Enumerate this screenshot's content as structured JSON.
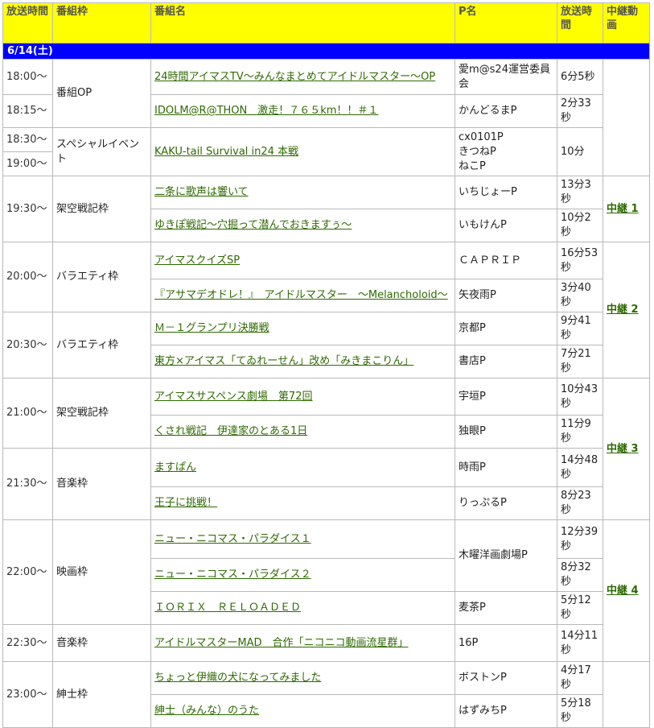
{
  "headers": {
    "time": "放送時間",
    "slot": "番組枠",
    "program": "番組名",
    "producer": "P名",
    "duration": "放送時間",
    "relay": "中継動画"
  },
  "date": "6/14(土)",
  "rows": [
    {
      "time": "18:00～",
      "slot": "番組OP",
      "program": "24時間アイマスTV～みんなまとめてアイドルマスター～OP",
      "producer": "愛m@s24運営委員会",
      "duration": "6分5秒"
    },
    {
      "time": "18:15～",
      "program": "IDOLM@R@THON　激走！７６５km！！＃１",
      "producer": "かんどるまP",
      "duration": "2分33秒"
    },
    {
      "time": "18:30～",
      "slot": "スペシャルイベント",
      "program": "KAKU-tail Survival in24 本戦",
      "producer_lines": [
        "cx0101P",
        "きつねP",
        "ねこP"
      ],
      "duration": "10分"
    },
    {
      "time": "19:00～"
    },
    {
      "time": "19:30～",
      "slot": "架空戦記枠",
      "program": "二条に歌声は響いて",
      "producer": "いちじょーP",
      "duration": "13分3秒",
      "relay": "中継 1"
    },
    {
      "program": "ゆきぽ戦記～穴掘って潜んでおきますぅ～",
      "producer": "いもけんP",
      "duration": "10分2秒"
    },
    {
      "time": "20:00～",
      "slot": "バラエティ枠",
      "program": "アイマスクイズSP",
      "producer": "ＣＡＰＲＩＰ",
      "duration": "16分53秒",
      "relay": "中継 2"
    },
    {
      "program": "『アサマデオドレ！』　アイドルマスター　～Melancholoid～",
      "producer": "矢夜雨P",
      "duration": "3分40秒"
    },
    {
      "time": "20:30～",
      "slot": "バラエティ枠",
      "program": "Ｍ－１グランプリ決勝戦",
      "producer": "京都P",
      "duration": "9分41秒"
    },
    {
      "program": "東方×アイマス「てゐれーせん」改め「みきまこりん」",
      "producer": "書店P",
      "duration": "7分21秒"
    },
    {
      "time": "21:00～",
      "slot": "架空戦記枠",
      "program": "アイマスサスペンス劇場　第72回",
      "producer": "宇垣P",
      "duration": "10分43秒",
      "relay": "中継 3"
    },
    {
      "program": "くされ戦記　伊達家のとある1日",
      "producer": "独眼P",
      "duration": "11分9秒"
    },
    {
      "time": "21:30～",
      "slot": "音楽枠",
      "program": "ますぱん",
      "producer": "時雨P",
      "duration": "14分48秒"
    },
    {
      "program": "王子に挑戦！",
      "producer": "りっぷるP",
      "duration": "8分23秒"
    },
    {
      "time": "22:00～",
      "slot": "映画枠",
      "program": "ニュー・ニコマス・パラダイス１",
      "producer": "木曜洋画劇場P",
      "duration": "12分39秒",
      "relay": "中継 4"
    },
    {
      "program": "ニュー・ニコマス・パラダイス２",
      "duration": "8分32秒"
    },
    {
      "program": "ＩＯＲＩＸ　ＲＥＬＯＡＤＥＤ",
      "producer": "麦茶P",
      "duration": "5分12秒"
    },
    {
      "time": "22:30～",
      "slot": "音楽枠",
      "program": "アイドルマスターMAD　合作「ニコニコ動画流星群」",
      "producer": "16P",
      "duration": "14分11秒"
    },
    {
      "time": "23:00～",
      "slot": "紳士枠",
      "program": "ちょっと伊織の犬になってみました",
      "producer": "ボストンP",
      "duration": "4分17秒"
    },
    {
      "program": "紳士（みんな）のうた",
      "producer": "はずみちP",
      "duration": "5分18秒"
    }
  ],
  "colors": {
    "header_bg": "#ffff00",
    "date_bg": "#0000ff",
    "link": "#2d6a00",
    "border": "#b9b9b9"
  }
}
